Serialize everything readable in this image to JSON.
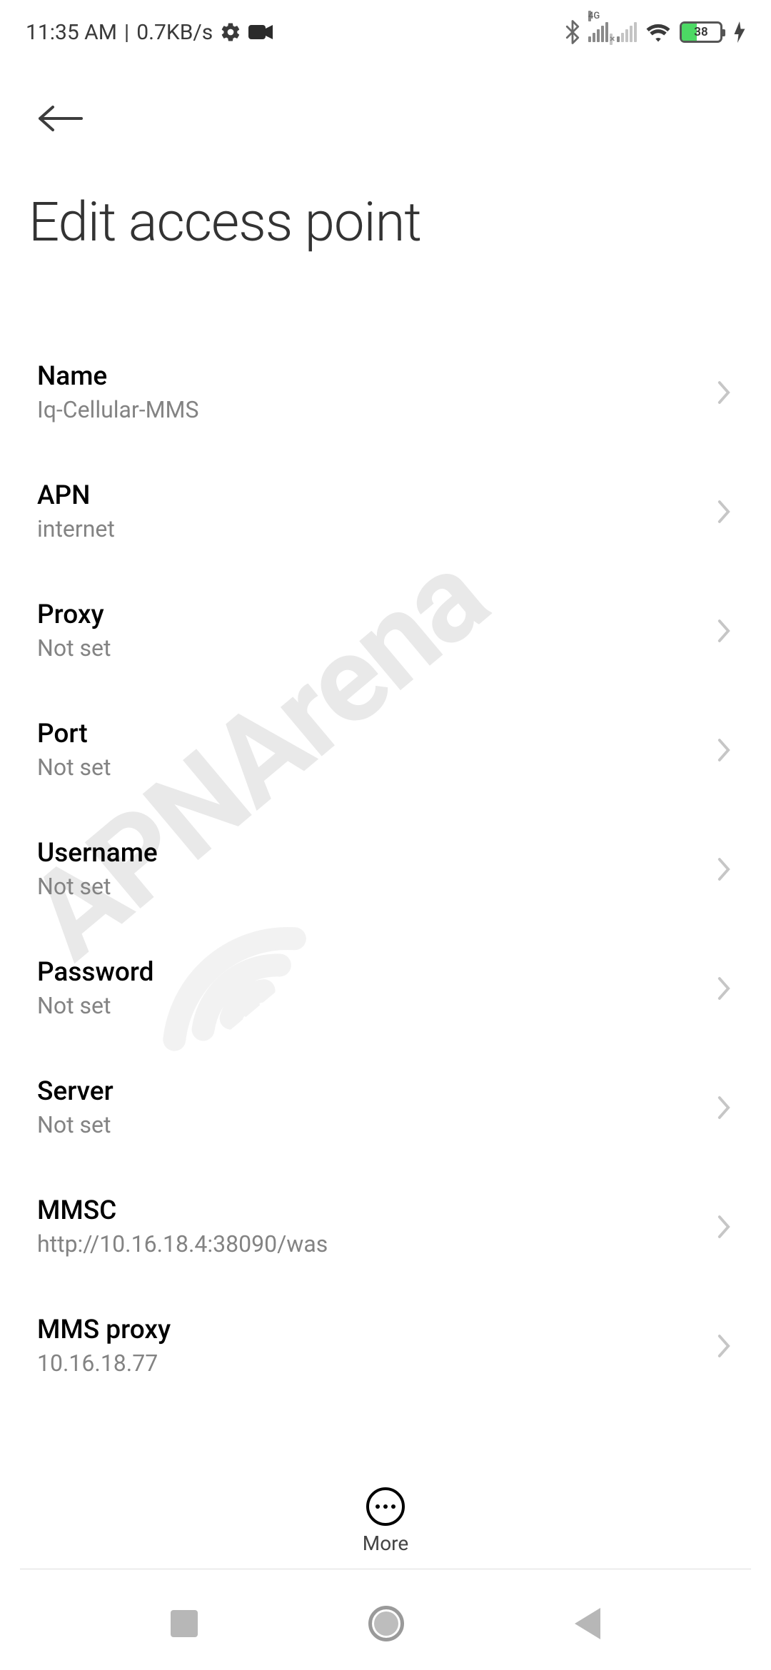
{
  "status": {
    "time": "11:35 AM",
    "sep": "|",
    "data_rate": "0.7KB/s",
    "signal1_label": "4G",
    "battery_pct": "38"
  },
  "header": {
    "title": "Edit access point"
  },
  "rows": [
    {
      "label": "Name",
      "value": "Iq-Cellular-MMS"
    },
    {
      "label": "APN",
      "value": "internet"
    },
    {
      "label": "Proxy",
      "value": "Not set"
    },
    {
      "label": "Port",
      "value": "Not set"
    },
    {
      "label": "Username",
      "value": "Not set"
    },
    {
      "label": "Password",
      "value": "Not set"
    },
    {
      "label": "Server",
      "value": "Not set"
    },
    {
      "label": "MMSC",
      "value": "http://10.16.18.4:38090/was"
    },
    {
      "label": "MMS proxy",
      "value": "10.16.18.77"
    }
  ],
  "more": {
    "label": "More"
  },
  "watermark": "APNArena"
}
